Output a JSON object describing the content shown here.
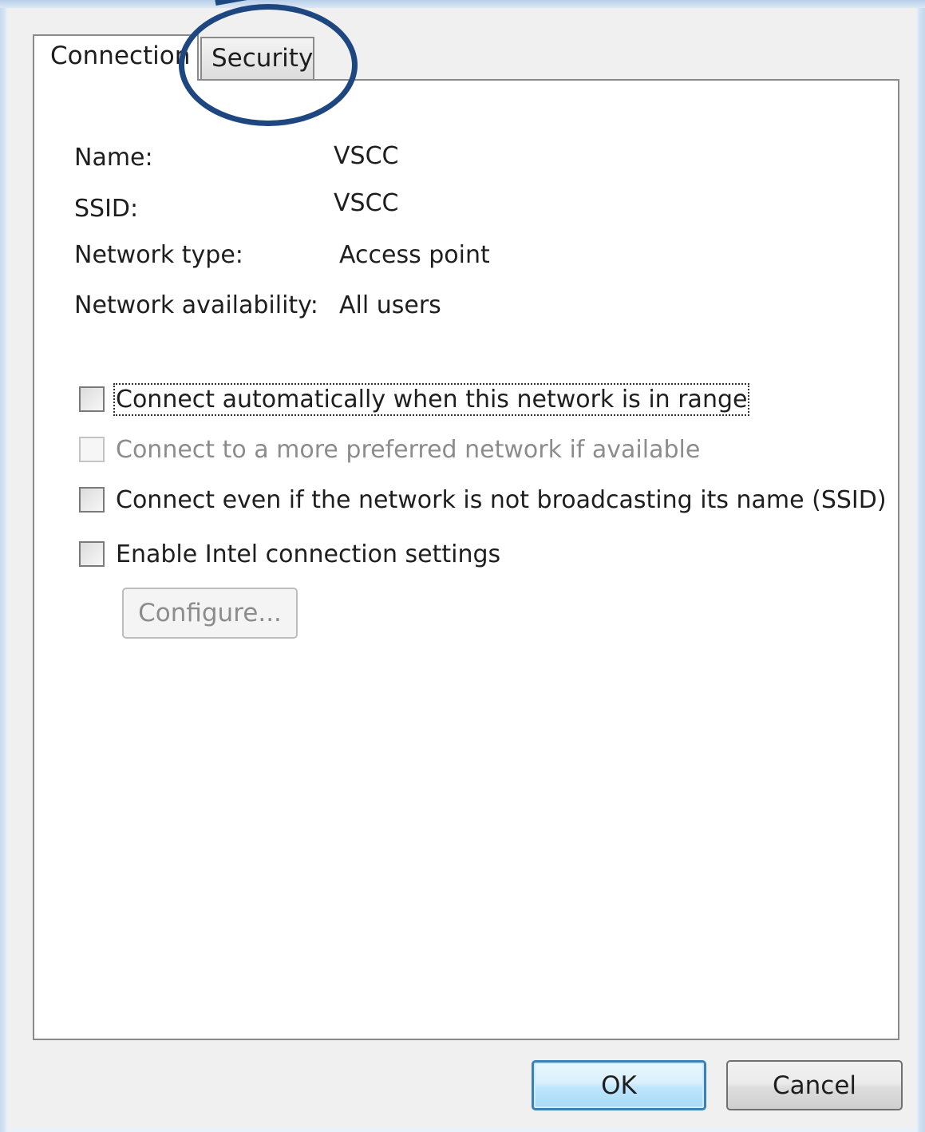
{
  "tabs": {
    "connection": "Connection",
    "security": "Security"
  },
  "info": {
    "name_label": "Name:",
    "name_value": "VSCC",
    "ssid_label": "SSID:",
    "ssid_value": "VSCC",
    "network_type_label": "Network type:",
    "network_type_value": "Access point",
    "availability_label": "Network availability:",
    "availability_value": "All users"
  },
  "options": [
    {
      "label": "Connect automatically when this network is in range",
      "checked": false,
      "enabled": true,
      "focused": true
    },
    {
      "label": "Connect to a more preferred network if available",
      "checked": false,
      "enabled": false
    },
    {
      "label": "Connect even if the network is not broadcasting its name (SSID)",
      "checked": false,
      "enabled": true
    },
    {
      "label": "Enable Intel connection settings",
      "checked": false,
      "enabled": true
    }
  ],
  "buttons": {
    "configure": "Configure...",
    "ok": "OK",
    "cancel": "Cancel"
  },
  "annotation": {
    "highlight_color": "#1e4680",
    "highlighted": "Security tab"
  }
}
